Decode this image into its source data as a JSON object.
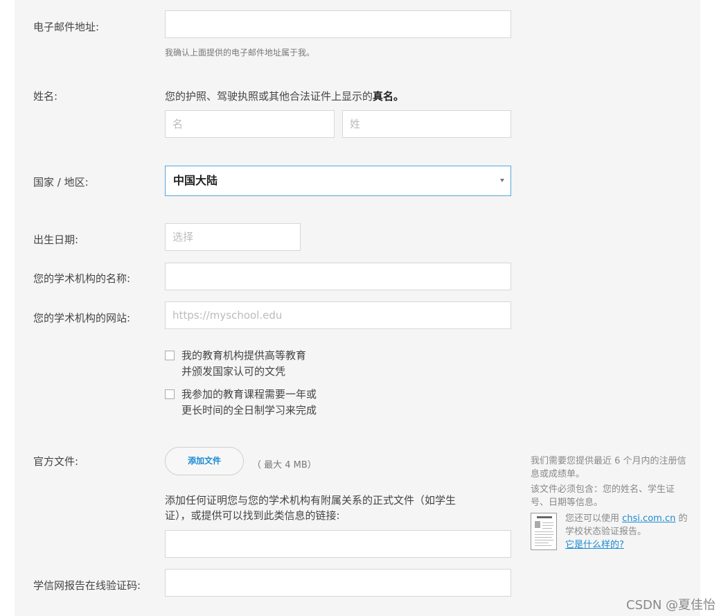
{
  "form": {
    "email": {
      "label": "电子邮件地址:",
      "value": "",
      "hint": "我确认上面提供的电子邮件地址属于我。"
    },
    "name": {
      "label": "姓名:",
      "desc_prefix": "您的护照、驾驶执照或其他合法证件上显示的",
      "desc_bold": "真名。",
      "first_placeholder": "名",
      "last_placeholder": "姓"
    },
    "country": {
      "label": "国家 / 地区:",
      "selected": "中国大陆"
    },
    "birthdate": {
      "label": "出生日期:",
      "placeholder": "选择"
    },
    "institution_name": {
      "label": "您的学术机构的名称:",
      "value": ""
    },
    "institution_site": {
      "label": "您的学术机构的网站:",
      "placeholder": "https://myschool.edu"
    },
    "checkboxes": [
      {
        "line1": "我的教育机构提供高等教育",
        "line2": "并颁发国家认可的文凭",
        "checked": false
      },
      {
        "line1": "我参加的教育课程需要一年或",
        "line2": "更长时间的全日制学习来完成",
        "checked": false
      }
    ],
    "official_docs": {
      "label": "官方文件:",
      "add_button": "添加文件",
      "max_size": "（ 最大 4 MB）",
      "desc_line1": "添加任何证明您与您的学术机构有附属关系的正式文件（如学生",
      "desc_line2": "证），或提供可以找到此类信息的链接:",
      "link_value": ""
    },
    "chsi_code": {
      "label": "学信网报告在线验证码:",
      "value": ""
    }
  },
  "sidebar_note": {
    "p1_line1": "我们需要您提供最近 6 个月内的注册信",
    "p1_line2": "息或成绩单。",
    "p2_line1": "该文件必须包含：您的姓名、学生证",
    "p2_line2": "号、日期等信息。",
    "p3_prefix": "您还可以使用 ",
    "p3_link": "chsi.com.cn",
    "p3_suffix": " 的",
    "p3_line2": "学校状态验证报告。",
    "example_link": "它是什么样的?"
  },
  "watermark": "CSDN @夏佳怡",
  "colors": {
    "accent": "#1a8ad5",
    "focus_border": "#51a7e0",
    "panel_bg": "#f5f5f5"
  }
}
